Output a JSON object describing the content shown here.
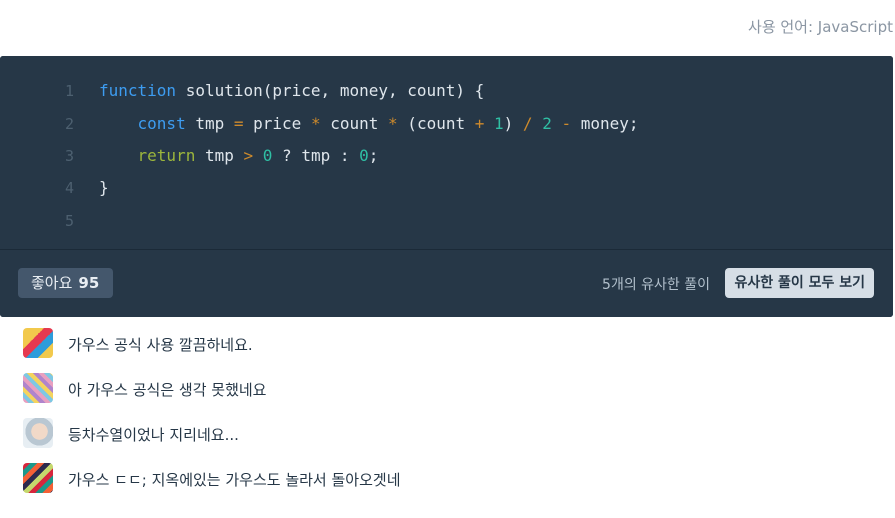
{
  "header": {
    "language_label": "사용 언어: JavaScript"
  },
  "code": {
    "lines": [
      {
        "number": "1",
        "tokens": [
          {
            "t": "function",
            "c": "kw"
          },
          {
            "t": " solution(price, money, count) {",
            "c": ""
          }
        ]
      },
      {
        "number": "2",
        "tokens": [
          {
            "t": "    ",
            "c": ""
          },
          {
            "t": "const",
            "c": "kw"
          },
          {
            "t": " tmp ",
            "c": ""
          },
          {
            "t": "=",
            "c": "op"
          },
          {
            "t": " price ",
            "c": ""
          },
          {
            "t": "*",
            "c": "op"
          },
          {
            "t": " count ",
            "c": ""
          },
          {
            "t": "*",
            "c": "op"
          },
          {
            "t": " (count ",
            "c": ""
          },
          {
            "t": "+",
            "c": "op"
          },
          {
            "t": " ",
            "c": ""
          },
          {
            "t": "1",
            "c": "num"
          },
          {
            "t": ") ",
            "c": ""
          },
          {
            "t": "/",
            "c": "op"
          },
          {
            "t": " ",
            "c": ""
          },
          {
            "t": "2",
            "c": "num"
          },
          {
            "t": " ",
            "c": ""
          },
          {
            "t": "-",
            "c": "op"
          },
          {
            "t": " money;",
            "c": ""
          }
        ]
      },
      {
        "number": "3",
        "tokens": [
          {
            "t": "    ",
            "c": ""
          },
          {
            "t": "return",
            "c": "ret"
          },
          {
            "t": " tmp ",
            "c": ""
          },
          {
            "t": ">",
            "c": "op"
          },
          {
            "t": " ",
            "c": ""
          },
          {
            "t": "0",
            "c": "num"
          },
          {
            "t": " ? tmp : ",
            "c": ""
          },
          {
            "t": "0",
            "c": "num"
          },
          {
            "t": ";",
            "c": ""
          }
        ]
      },
      {
        "number": "4",
        "tokens": [
          {
            "t": "}",
            "c": ""
          }
        ]
      },
      {
        "number": "5",
        "tokens": []
      }
    ]
  },
  "footer": {
    "like_label": "좋아요",
    "like_count": "95",
    "similar_count_text": "5개의 유사한 풀이",
    "view_all_label": "유사한 풀이 모두 보기"
  },
  "comments": [
    {
      "text": "가우스 공식 사용 깔끔하네요.",
      "avatar": "avatar-1"
    },
    {
      "text": "아 가우스 공식은 생각 못했네요",
      "avatar": "avatar-2"
    },
    {
      "text": "등차수열이었나 지리네요...",
      "avatar": "avatar-3"
    },
    {
      "text": "가우스 ㄷㄷ; 지옥에있는 가우스도 놀라서 돌아오겟네",
      "avatar": "avatar-4"
    }
  ],
  "colors": {
    "code_bg": "#263747",
    "keyword": "#3d9cf0",
    "return_keyword": "#9cb63c",
    "operator": "#cd8a2c",
    "number": "#2fbfa4"
  }
}
